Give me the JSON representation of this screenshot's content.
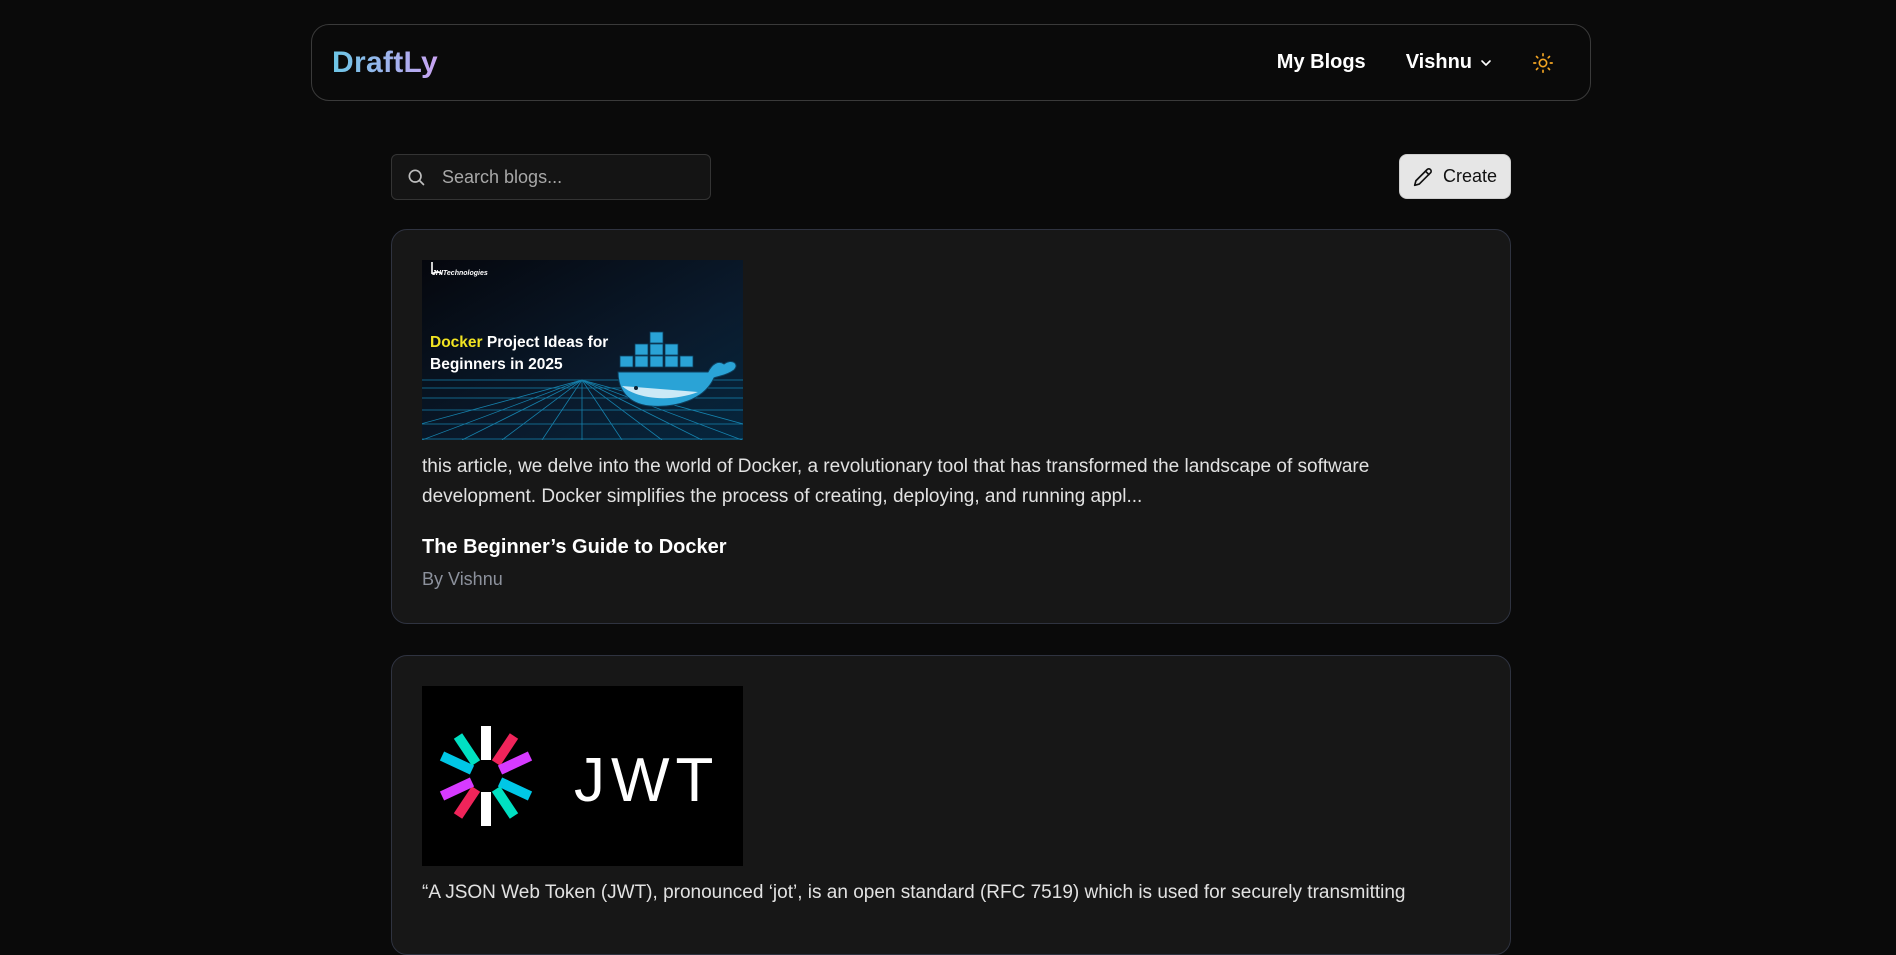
{
  "app": {
    "logo": "DraftLy"
  },
  "nav": {
    "my_blogs": "My Blogs",
    "user_name": "Vishnu"
  },
  "toolbar": {
    "search_placeholder": "Search blogs...",
    "create_label": "Create"
  },
  "posts": [
    {
      "thumbnail": {
        "brand": "JHITechnologies",
        "headline_accent": "Docker",
        "headline_rest_1": " Project Ideas for",
        "headline_line_2": "Beginners in 2025"
      },
      "excerpt": "this article, we delve into the world of Docker, a revolutionary tool that has transformed the landscape of software development. Docker simplifies the process of creating, deploying, and running appl...",
      "title": "The Beginner’s Guide to Docker",
      "author": "By Vishnu"
    },
    {
      "thumbnail": {
        "text": "JWT"
      },
      "excerpt": "“A JSON Web Token (JWT), pronounced ‘jot’, is an open standard (RFC 7519) which is used for securely transmitting"
    }
  ],
  "colors": {
    "background": "#0a0a0a",
    "card": "#171717",
    "logo_gradient_start": "#6cc6e6",
    "logo_gradient_end": "#c9a3f2",
    "sun_icon": "#f5a623",
    "docker_accent": "#f2e422"
  }
}
